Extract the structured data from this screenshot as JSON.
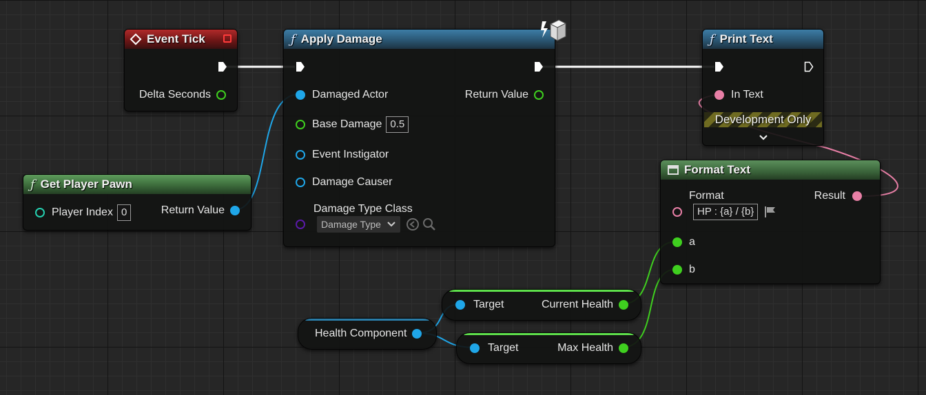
{
  "colors": {
    "exec": "#ffffff",
    "object": "#1fa6e8",
    "int": "#25d0b0",
    "float": "#3fcf1f",
    "class": "#5a1aa8",
    "text": "#e87fa6",
    "event_header": "#8a1f1f",
    "function_header": "#2f5f80",
    "pure_header": "#4b824a"
  },
  "nodes": {
    "event_tick": {
      "title": "Event Tick",
      "delta_seconds_label": "Delta Seconds"
    },
    "apply_damage": {
      "title": "Apply Damage",
      "inputs": {
        "damaged_actor": "Damaged Actor",
        "base_damage": "Base Damage",
        "base_damage_value": "0.5",
        "event_instigator": "Event Instigator",
        "damage_causer": "Damage Causer",
        "damage_type_class": "Damage Type Class",
        "damage_type_dropdown": "Damage Type"
      },
      "return_value_label": "Return Value",
      "badge_icon": "authority-cube-icon"
    },
    "print_text": {
      "title": "Print Text",
      "in_text_label": "In Text",
      "development_only": "Development Only",
      "expand_icon": "chevron-down-icon"
    },
    "get_player_pawn": {
      "title": "Get Player Pawn",
      "player_index_label": "Player Index",
      "player_index_value": "0",
      "return_value_label": "Return Value"
    },
    "format_text": {
      "title": "Format Text",
      "format_label": "Format",
      "format_value": "HP : {a} / {b}",
      "result_label": "Result",
      "pin_a": "a",
      "pin_b": "b"
    },
    "health_component": {
      "label": "Health Component"
    },
    "get_current_health": {
      "target_label": "Target",
      "output_label": "Current Health"
    },
    "get_max_health": {
      "target_label": "Target",
      "output_label": "Max Health"
    }
  }
}
